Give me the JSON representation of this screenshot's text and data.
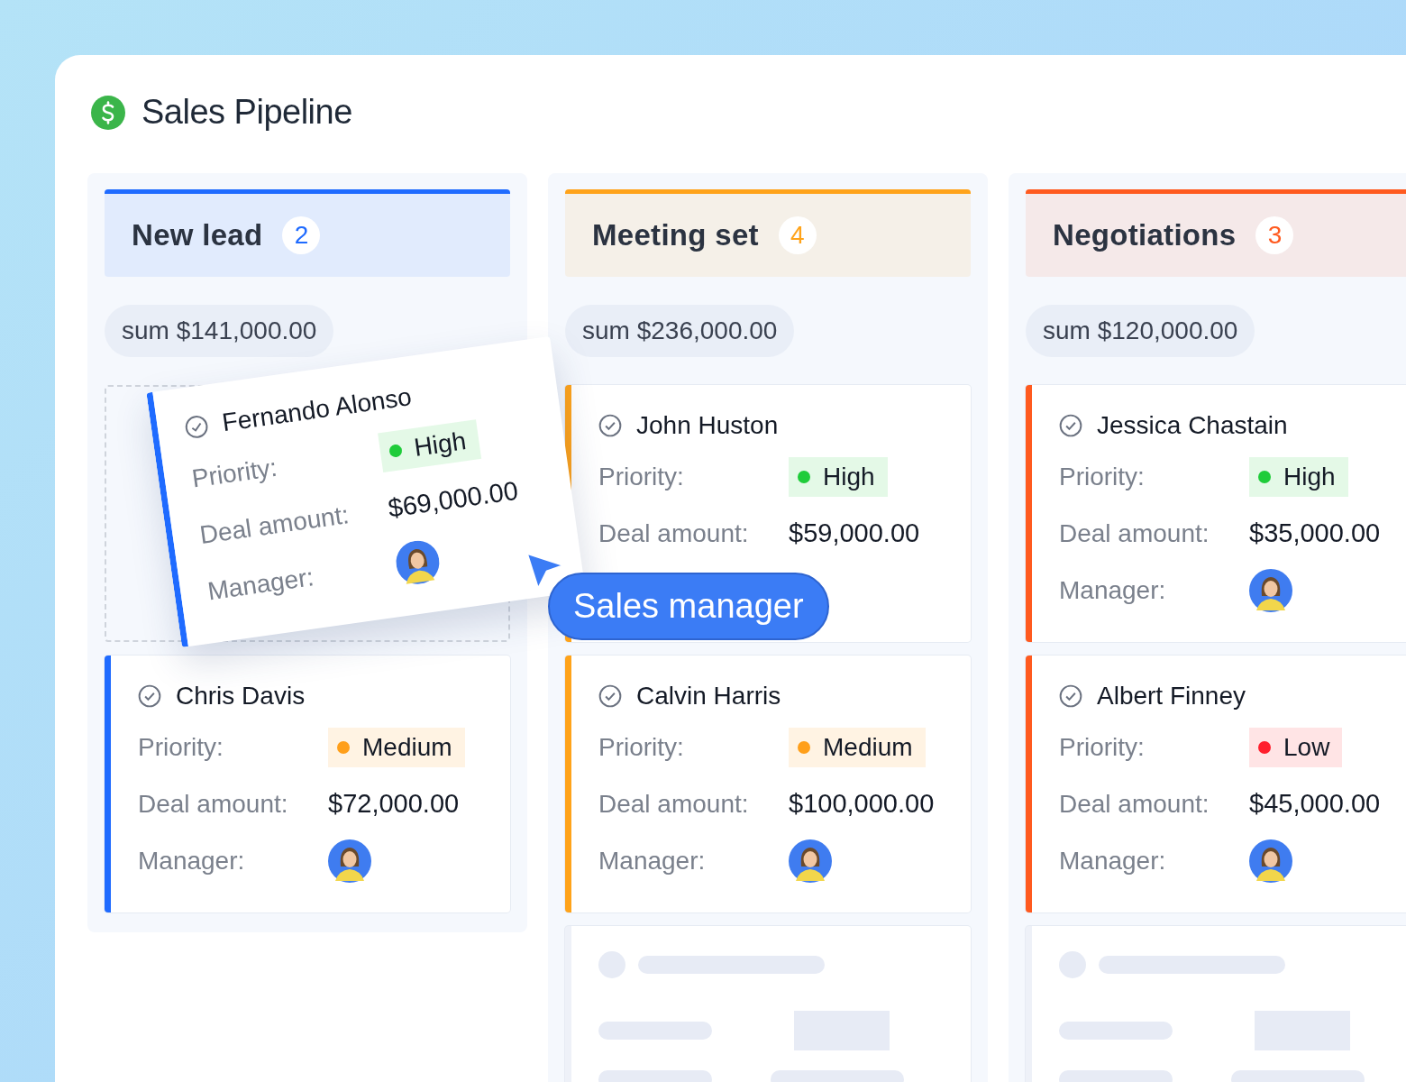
{
  "title": "Sales Pipeline",
  "columns": [
    {
      "name": "New lead",
      "count": "2",
      "color": "#1f6bff",
      "sum": "sum $141,000.00",
      "placeholder": true,
      "dragged": {
        "name": "Fernando Alonso",
        "priority_label": "Priority:",
        "priority": {
          "label": "High",
          "color": "#1fcc3a"
        },
        "amount_label": "Deal amount:",
        "amount": "$69,000.00",
        "manager_label": "Manager:"
      },
      "cards": [
        {
          "name": "Chris Davis",
          "priority_label": "Priority:",
          "priority": {
            "label": "Medium",
            "color": "#ff9f1a"
          },
          "amount_label": "Deal amount:",
          "amount": "$72,000.00",
          "manager_label": "Manager:"
        }
      ]
    },
    {
      "name": "Meeting set",
      "count": "4",
      "color": "#ffa31a",
      "sum": "sum $236,000.00",
      "placeholder": false,
      "cards": [
        {
          "name": "John Huston",
          "priority_label": "Priority:",
          "priority": {
            "label": "High",
            "color": "#1fcc3a"
          },
          "amount_label": "Deal amount:",
          "amount": "$59,000.00"
        },
        {
          "name": "Calvin Harris",
          "priority_label": "Priority:",
          "priority": {
            "label": "Medium",
            "color": "#ff9f1a"
          },
          "amount_label": "Deal amount:",
          "amount": "$100,000.00",
          "manager_label": "Manager:"
        }
      ],
      "skeletons": [
        {
          "kind": "skeleton"
        }
      ]
    },
    {
      "name": "Negotiations",
      "count": "3",
      "color": "#ff5a1f",
      "sum": "sum $120,000.00",
      "placeholder": false,
      "cards": [
        {
          "name": "Jessica Chastain",
          "priority_label": "Priority:",
          "priority": {
            "label": "High",
            "color": "#1fcc3a"
          },
          "amount_label": "Deal amount:",
          "amount": "$35,000.00",
          "manager_label": "Manager:"
        },
        {
          "name": "Albert Finney",
          "priority_label": "Priority:",
          "priority": {
            "label": "Low",
            "color": "#ff1f2d"
          },
          "amount_label": "Deal amount:",
          "amount": "$45,000.00",
          "manager_label": "Manager:"
        }
      ],
      "skeletons": [
        {
          "kind": "skeleton"
        }
      ]
    }
  ],
  "cursor_label": "Sales manager"
}
